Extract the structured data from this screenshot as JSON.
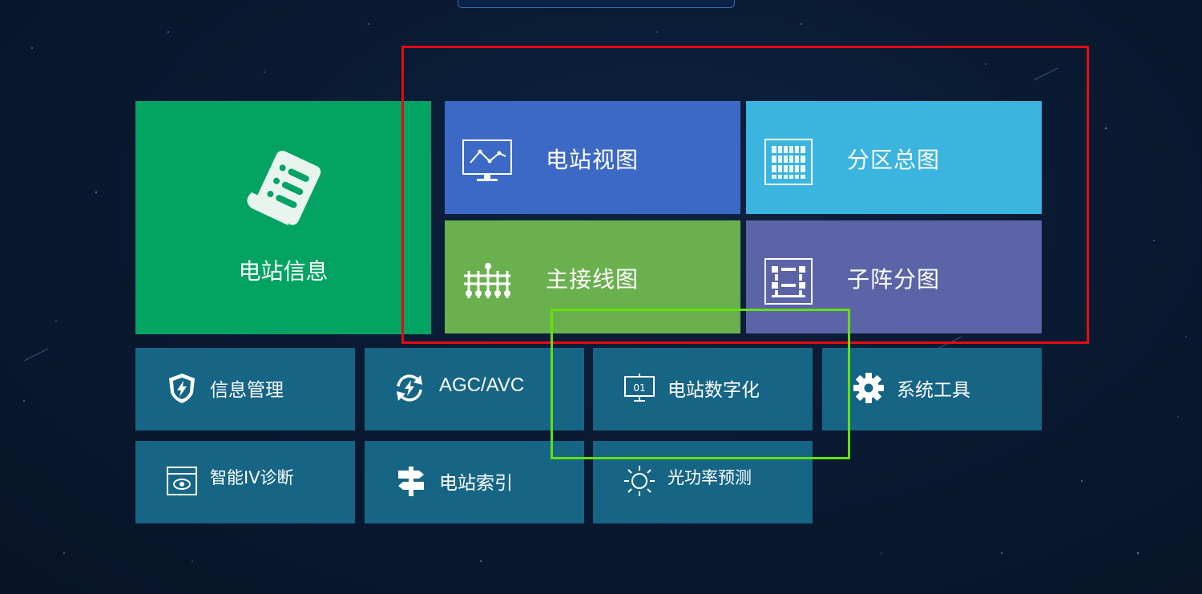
{
  "app": {
    "accent_colors": {
      "background": "#0a1a32",
      "station_info_tile": "#02a363",
      "station_view_tile": "#3c69c6",
      "zone_overview_tile": "#3bb4df",
      "main_wiring_tile": "#6bb04f",
      "subarray_tile": "#5c64a8",
      "small_tile": "#176585",
      "annotation_red": "#e30b12",
      "annotation_green": "#62e00f"
    }
  },
  "tiles": {
    "station_info": {
      "label": "电站信息",
      "icon": "document-list-icon"
    },
    "station_view": {
      "label": "电站视图",
      "icon": "monitor-chart-icon"
    },
    "zone_overview": {
      "label": "分区总图",
      "icon": "grid-icon"
    },
    "main_wiring": {
      "label": "主接线图",
      "icon": "wiring-diagram-icon"
    },
    "subarray": {
      "label": "子阵分图",
      "icon": "subarray-icon"
    },
    "info_mgmt": {
      "label": "信息管理",
      "icon": "shield-bolt-icon"
    },
    "agc_avc": {
      "label": "AGC/AVC",
      "icon": "cycle-bolt-icon"
    },
    "digital": {
      "label": "电站数字化",
      "icon": "monitor-01-icon",
      "icon_text": "01"
    },
    "system_tools": {
      "label": "系统工具",
      "icon": "gear-icon"
    },
    "iv_diag": {
      "label": "智能IV诊断",
      "icon": "window-eye-icon"
    },
    "station_index": {
      "label": "电站索引",
      "icon": "signpost-icon"
    },
    "power_forecast": {
      "label": "光功率预测",
      "icon": "sun-icon"
    }
  }
}
